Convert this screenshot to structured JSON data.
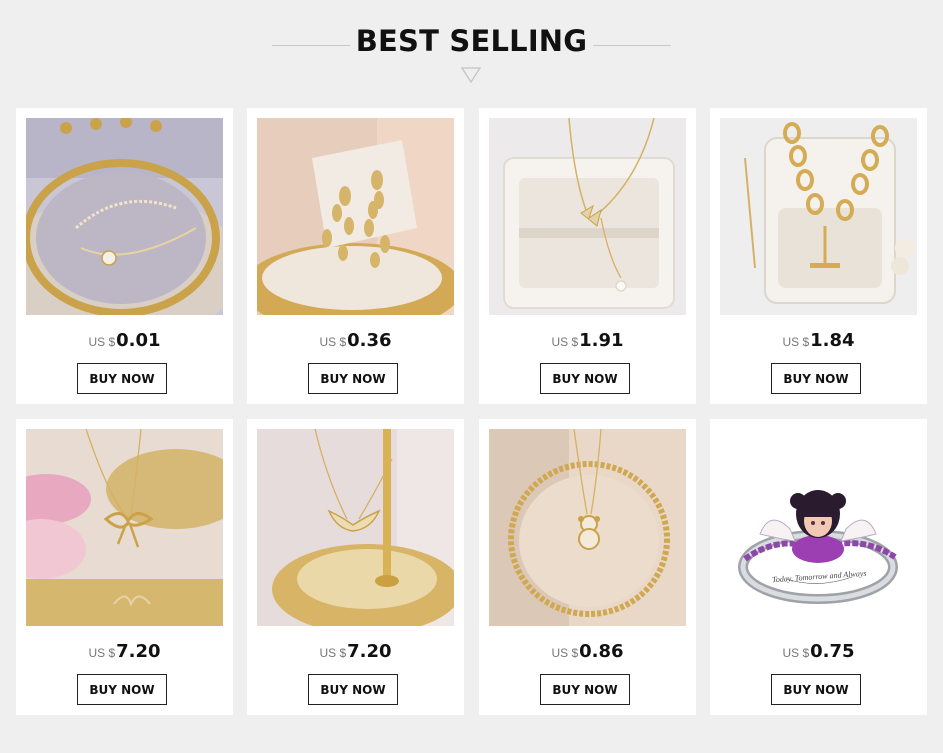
{
  "section": {
    "title": "BEST SELLING"
  },
  "products": [
    {
      "currency": "US $",
      "price": "0.01",
      "button": "BUY NOW",
      "image": "gold-pearl-necklace-photo"
    },
    {
      "currency": "US $",
      "price": "0.36",
      "button": "BUY NOW",
      "image": "gold-leaf-earrings-photo"
    },
    {
      "currency": "US $",
      "price": "1.91",
      "button": "BUY NOW",
      "image": "butterfly-pendant-necklace-photo"
    },
    {
      "currency": "US $",
      "price": "1.84",
      "button": "BUY NOW",
      "image": "gold-chain-toggle-necklace-photo"
    },
    {
      "currency": "US $",
      "price": "7.20",
      "button": "BUY NOW",
      "image": "bow-pendant-necklace-photo"
    },
    {
      "currency": "US $",
      "price": "7.20",
      "button": "BUY NOW",
      "image": "wing-pendant-necklace-photo"
    },
    {
      "currency": "US $",
      "price": "0.86",
      "button": "BUY NOW",
      "image": "bear-pendant-necklace-photo"
    },
    {
      "currency": "US $",
      "price": "0.75",
      "button": "BUY NOW",
      "image": "angel-girl-ring-photo",
      "engraving": "Today, Tomorrow and Always"
    }
  ],
  "colors": {
    "background": "#efefef",
    "card": "#ffffff",
    "text": "#111111",
    "muted": "#777777",
    "gold": "#c9a24a"
  }
}
